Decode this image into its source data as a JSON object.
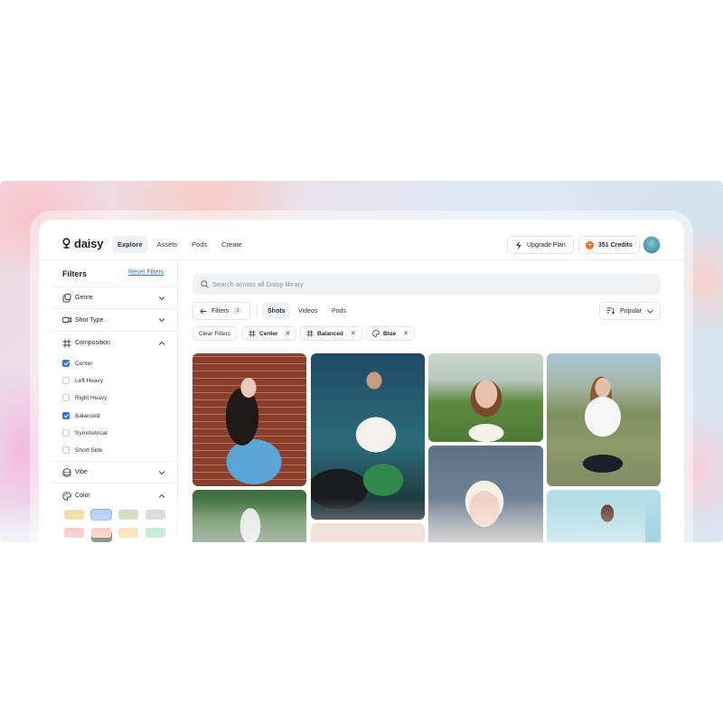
{
  "app": {
    "brand": "daisy",
    "nav": [
      {
        "label": "Explore",
        "active": true
      },
      {
        "label": "Assets",
        "active": false
      },
      {
        "label": "Pods",
        "active": false
      },
      {
        "label": "Create",
        "active": false
      }
    ],
    "upgrade_label": "Upgrade Plan",
    "credits_label": "351 Credits"
  },
  "sidebar": {
    "title": "Filters",
    "reset_label": "Reset Filters",
    "sections": [
      {
        "label": "Genre",
        "icon": "genre-icon",
        "expanded": false
      },
      {
        "label": "Shot Type",
        "icon": "video-icon",
        "expanded": false
      },
      {
        "label": "Composition",
        "icon": "frame-icon",
        "expanded": true
      },
      {
        "label": "Vibe",
        "icon": "vibe-icon",
        "expanded": false
      },
      {
        "label": "Color",
        "icon": "palette-icon",
        "expanded": true
      }
    ],
    "composition_options": [
      {
        "label": "Center",
        "checked": true
      },
      {
        "label": "Left Heavy",
        "checked": false
      },
      {
        "label": "Right Heavy",
        "checked": false
      },
      {
        "label": "Balanced",
        "checked": true
      },
      {
        "label": "Symmetrical",
        "checked": false
      },
      {
        "label": "Short Side",
        "checked": false
      }
    ],
    "tooltip": "Cool",
    "color_swatches": [
      "#ecd99a",
      "#a7c8f2",
      "#c9d8b4",
      "#d3d3d6",
      "#f4aaaa",
      "#f3b79a",
      "#f2d08e",
      "#9fe0b6"
    ]
  },
  "main": {
    "search_placeholder": "Search across all Daisy library",
    "filters_label": "Filters",
    "filters_count": "3",
    "tabs": [
      {
        "label": "Shots",
        "active": true
      },
      {
        "label": "Videos",
        "active": false
      },
      {
        "label": "Pods",
        "active": false
      }
    ],
    "sort_label": "Popular",
    "clear_label": "Clear Filters",
    "chips": [
      {
        "label": "Center",
        "icon": "frame-icon"
      },
      {
        "label": "Balanced",
        "icon": "frame-icon"
      },
      {
        "label": "Blue",
        "icon": "palette-icon"
      }
    ]
  },
  "colors": {
    "accent": "#2f74e0",
    "credits_badge": "#f56a22"
  }
}
